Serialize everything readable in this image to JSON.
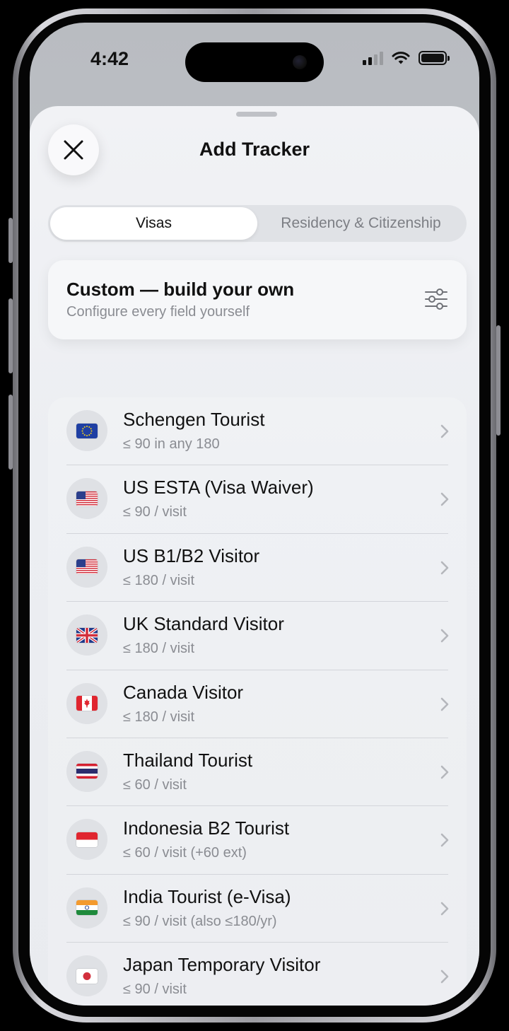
{
  "status_bar": {
    "time": "4:42"
  },
  "sheet": {
    "title": "Add Tracker",
    "tabs": [
      {
        "label": "Visas",
        "selected": true
      },
      {
        "label": "Residency & Citizenship",
        "selected": false
      }
    ],
    "custom": {
      "title": "Custom — build your own",
      "subtitle": "Configure every field yourself"
    },
    "presets": [
      {
        "title": "Schengen Tourist",
        "subtitle": "≤ 90 in any 180",
        "flag": "eu"
      },
      {
        "title": "US ESTA (Visa Waiver)",
        "subtitle": "≤ 90 / visit",
        "flag": "us"
      },
      {
        "title": "US B1/B2 Visitor",
        "subtitle": "≤ 180 / visit",
        "flag": "us"
      },
      {
        "title": "UK Standard Visitor",
        "subtitle": "≤ 180 / visit",
        "flag": "uk"
      },
      {
        "title": "Canada Visitor",
        "subtitle": "≤ 180 / visit",
        "flag": "ca"
      },
      {
        "title": "Thailand Tourist",
        "subtitle": "≤ 60 / visit",
        "flag": "th"
      },
      {
        "title": "Indonesia B2 Tourist",
        "subtitle": "≤ 60 / visit (+60 ext)",
        "flag": "id"
      },
      {
        "title": "India Tourist (e-Visa)",
        "subtitle": "≤ 90 / visit (also ≤180/yr)",
        "flag": "in"
      },
      {
        "title": "Japan Temporary Visitor",
        "subtitle": "≤ 90 / visit",
        "flag": "jp"
      }
    ]
  },
  "icons": {
    "close": "close-icon",
    "settings": "sliders-icon",
    "chevron": "chevron-right-icon"
  }
}
